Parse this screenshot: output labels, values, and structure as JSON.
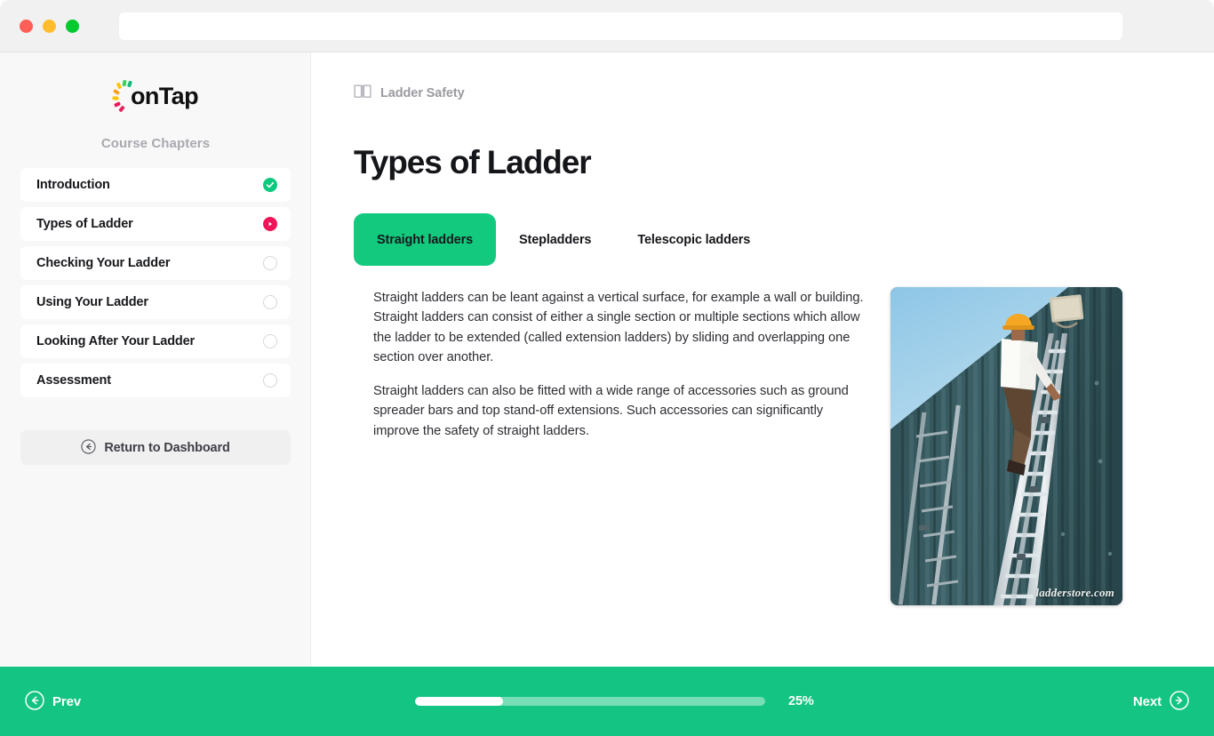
{
  "browser": {
    "url_value": "",
    "url_placeholder": "",
    "traffic_lights": [
      "close",
      "minimize",
      "zoom"
    ]
  },
  "sidebar": {
    "logo_text": "onTap",
    "logo_colors": [
      "#17b978",
      "#3ecf5e",
      "#ffc400",
      "#ff9f1c",
      "#f0145a",
      "#e0245e"
    ],
    "section_title": "Course Chapters",
    "items": [
      {
        "label": "Introduction",
        "status": "complete",
        "icon": "check-circle-icon"
      },
      {
        "label": "Types of Ladder",
        "status": "current",
        "icon": "play-circle-icon"
      },
      {
        "label": "Checking Your Ladder",
        "status": "pending",
        "icon": "empty-circle-icon"
      },
      {
        "label": "Using Your Ladder",
        "status": "pending",
        "icon": "empty-circle-icon"
      },
      {
        "label": "Looking After Your Ladder",
        "status": "pending",
        "icon": "empty-circle-icon"
      },
      {
        "label": "Assessment",
        "status": "pending",
        "icon": "empty-circle-icon"
      }
    ],
    "return_button": {
      "label": "Return to Dashboard",
      "icon": "arrow-left-circle-icon"
    }
  },
  "main": {
    "breadcrumb": {
      "icon": "book-icon",
      "label": "Ladder Safety"
    },
    "page_title": "Types of Ladder",
    "tabs": [
      {
        "label": "Straight ladders",
        "active": true
      },
      {
        "label": "Stepladders",
        "active": false
      },
      {
        "label": "Telescopic ladders",
        "active": false
      }
    ],
    "paragraphs": [
      "Straight ladders can be leant against a vertical surface, for example a wall or building. Straight ladders can consist of either a single section or multiple sections which allow the ladder to be extended (called extension ladders) by sliding and overlapping one section over another.",
      "Straight ladders can also be fitted with a wide range of accessories such as ground spreader bars and top stand-off extensions. Such accessories can significantly improve the safety of straight ladders."
    ],
    "photo": {
      "alt": "Worker in hard hat climbing an aluminium extension ladder against a dark corrugated metal building",
      "watermark": "ladderstore.com"
    }
  },
  "footer": {
    "prev_label": "Prev",
    "prev_icon": "arrow-left-circle-icon",
    "next_label": "Next",
    "next_icon": "arrow-right-circle-icon",
    "progress_percent_label": "25%",
    "progress_percent_value": 25,
    "accent_color": "#13c482"
  }
}
